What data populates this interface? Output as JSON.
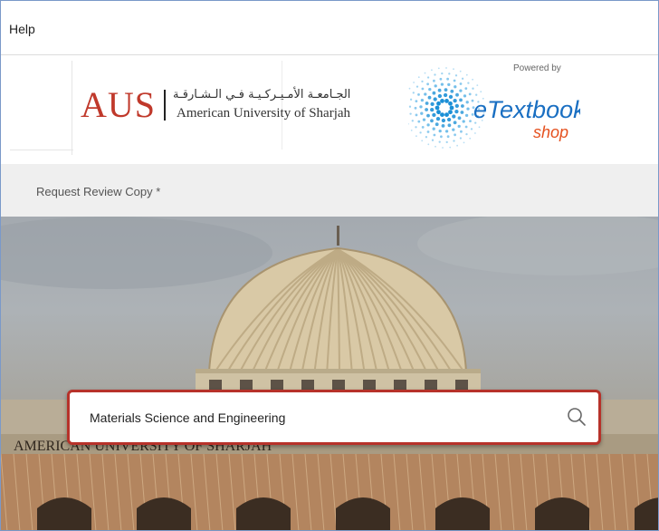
{
  "topbar": {
    "help_label": "Help"
  },
  "logos": {
    "aus_abbr": "AUS",
    "aus_arabic": "الجـامعـة الأمـيـركـيـة فـي الـشـارقـة",
    "aus_english": "American University of Sharjah",
    "powered_by": "Powered by",
    "etextbook": "eTextbook",
    "shop": "shop"
  },
  "nav": {
    "request_review_copy": "Request Review Copy *"
  },
  "hero": {
    "building_inscription": "AMERICAN UNIVERSITY OF SHARJAH"
  },
  "search": {
    "value": "Materials Science and Engineering",
    "icon": "search-icon"
  },
  "colors": {
    "accent": "#b7322a",
    "aus_red": "#c0392b",
    "etb_blue": "#1a6fc2",
    "etb_orange": "#e5501e"
  }
}
